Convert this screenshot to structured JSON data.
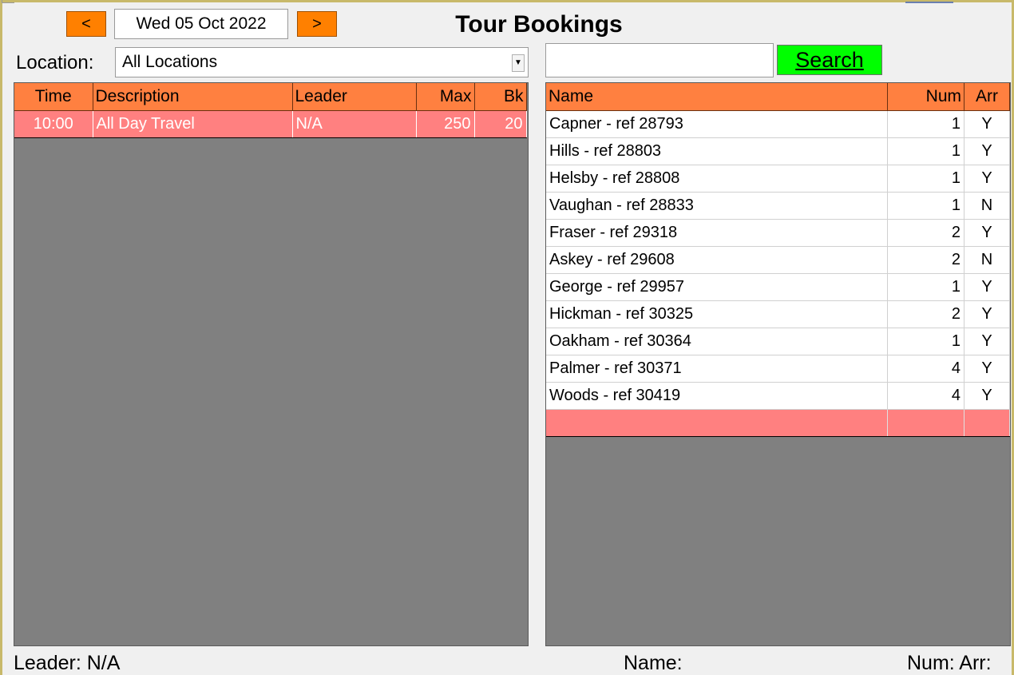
{
  "nav": {
    "prev_label": "<",
    "next_label": ">",
    "date": "Wed 05 Oct 2022"
  },
  "title": "Tour Bookings",
  "location": {
    "label": "Location:",
    "selected": "All Locations"
  },
  "search": {
    "value": "",
    "button_label": "Search"
  },
  "tours": {
    "headers": {
      "time": "Time",
      "description": "Description",
      "leader": "Leader",
      "max": "Max",
      "bk": "Bk"
    },
    "rows": [
      {
        "time": "10:00",
        "description": "All Day Travel",
        "leader": "N/A",
        "max": "250",
        "bk": "20"
      }
    ]
  },
  "bookings": {
    "headers": {
      "name": "Name",
      "num": "Num",
      "arr": "Arr"
    },
    "rows": [
      {
        "name": "Capner - ref 28793",
        "num": "1",
        "arr": "Y"
      },
      {
        "name": "Hills - ref 28803",
        "num": "1",
        "arr": "Y"
      },
      {
        "name": "Helsby - ref 28808",
        "num": "1",
        "arr": "Y"
      },
      {
        "name": "Vaughan - ref 28833",
        "num": "1",
        "arr": "N"
      },
      {
        "name": "Fraser - ref 29318",
        "num": "2",
        "arr": "Y"
      },
      {
        "name": "Askey - ref 29608",
        "num": "2",
        "arr": "N"
      },
      {
        "name": "George - ref 29957",
        "num": "1",
        "arr": "Y"
      },
      {
        "name": "Hickman - ref 30325",
        "num": "2",
        "arr": "Y"
      },
      {
        "name": "Oakham - ref 30364",
        "num": "1",
        "arr": "Y"
      },
      {
        "name": "Palmer - ref 30371",
        "num": "4",
        "arr": "Y"
      },
      {
        "name": "Woods - ref 30419",
        "num": "4",
        "arr": "Y"
      }
    ]
  },
  "footer": {
    "leader": "Leader:  N/A",
    "name": "Name:",
    "num_arr": "Num: Arr:"
  },
  "colors": {
    "header_orange": "#ff8040",
    "nav_orange": "#ff8000",
    "selected_row": "#ff8080",
    "search_green": "#00ff00",
    "grid_gray": "#808080"
  }
}
